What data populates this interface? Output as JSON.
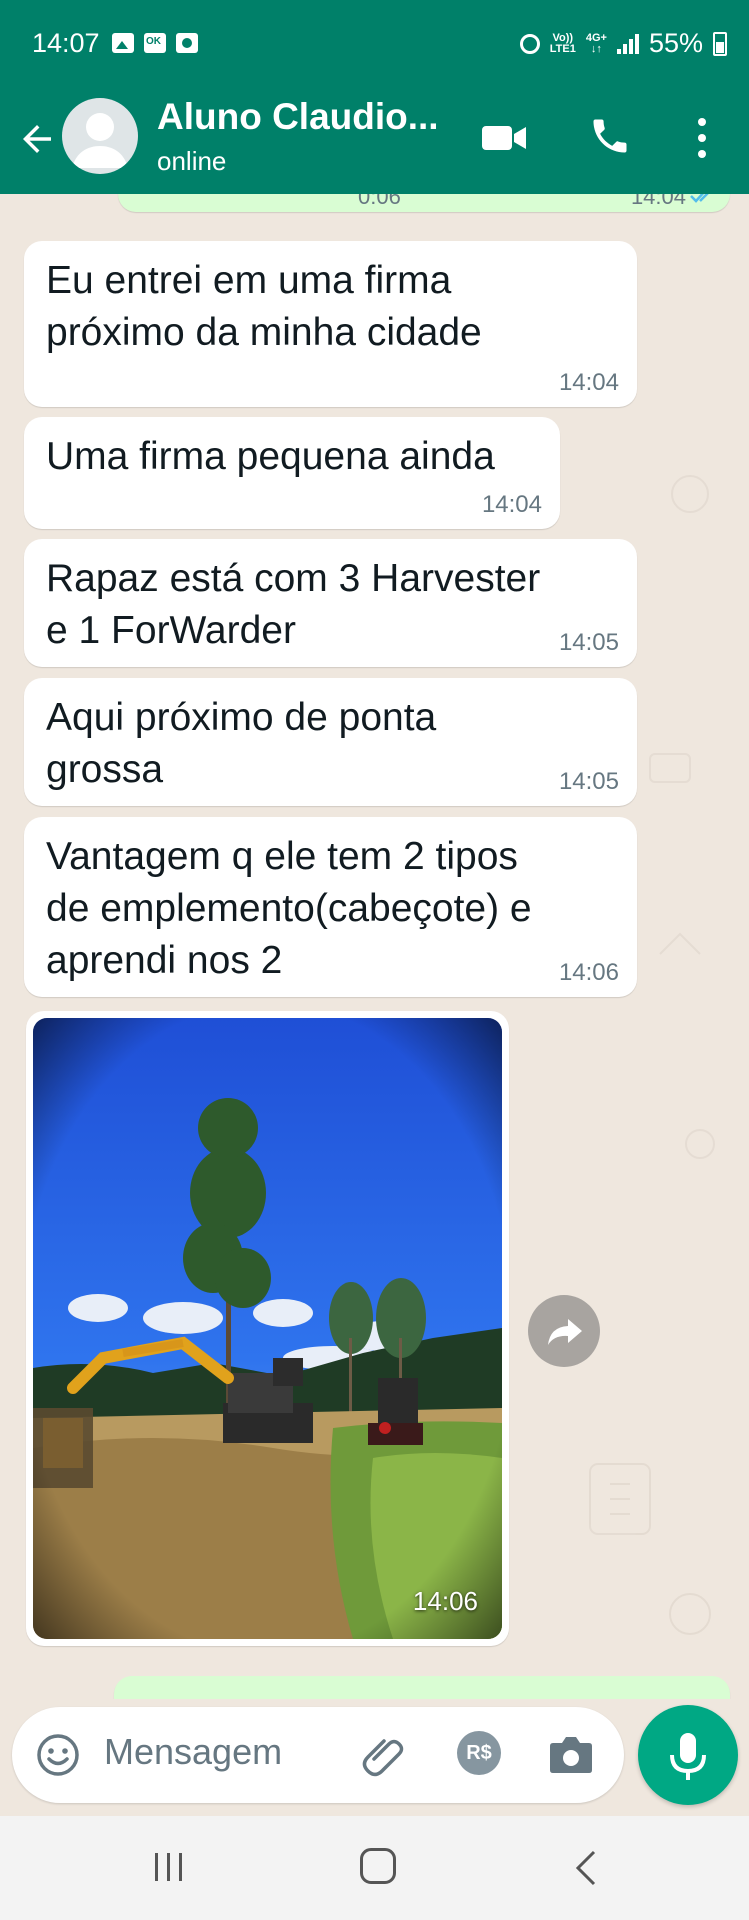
{
  "status_bar": {
    "time": "14:07",
    "volte_top": "Vo))",
    "volte_bottom": "LTE1",
    "network_top": "4G+",
    "network_bottom": "↓↑",
    "battery": "55%"
  },
  "header": {
    "contact_name": "Aluno Claudio...",
    "contact_status": "online"
  },
  "messages": [
    {
      "text_lines": [
        "Eu entrei em uma firma",
        "próximo da minha cidade"
      ],
      "time": "14:04",
      "direction": "in"
    },
    {
      "text_lines": [
        "Uma firma pequena ainda"
      ],
      "time": "14:04",
      "direction": "in"
    },
    {
      "text_lines": [
        "Rapaz está com 3 Harvester",
        "e 1 ForWarder"
      ],
      "time": "14:05",
      "direction": "in"
    },
    {
      "text_lines": [
        "Aqui próximo de ponta",
        "grossa"
      ],
      "time": "14:05",
      "direction": "in"
    },
    {
      "text_lines": [
        "Vantagem q ele tem 2 tipos",
        "de emplemento(cabeçote) e",
        "aprendi nos 2"
      ],
      "time": "14:06",
      "direction": "in"
    }
  ],
  "image_message": {
    "time": "14:06",
    "description_icon": "forestry-harvester-photo"
  },
  "partial_top_bubble": {
    "left_text": "0:06",
    "time": "14:04"
  },
  "composer": {
    "placeholder": "Mensagem",
    "pay_label": "R$"
  },
  "colors": {
    "header_green": "#008069",
    "accent_green": "#00a884",
    "chat_background": "#efe7de",
    "outgoing_bubble": "#d9fdd3",
    "incoming_bubble": "#ffffff",
    "timestamp_gray": "#667781"
  },
  "icons": [
    "image-icon",
    "key-icon",
    "record-icon",
    "alarm-icon",
    "signal-icon",
    "battery-icon",
    "back-arrow-icon",
    "video-call-icon",
    "phone-icon",
    "more-vert-icon",
    "forward-icon",
    "emoji-icon",
    "attach-icon",
    "camera-icon",
    "mic-icon"
  ]
}
